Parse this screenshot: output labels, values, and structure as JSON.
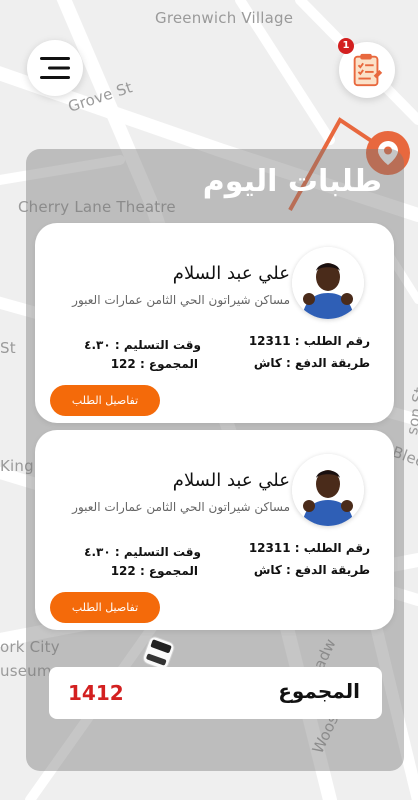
{
  "map": {
    "labels": {
      "greenwich": "Greenwich Village",
      "grove": "Grove St",
      "cherry": "Cherry Lane Theatre",
      "st": "St",
      "king": "King S",
      "york_city": "ork City",
      "museum": "useum",
      "hudson": "son St",
      "blee": "Blee",
      "road": "roadw",
      "woos": "Woos"
    }
  },
  "header": {
    "notification_count": "1"
  },
  "panel": {
    "title": "طلبات اليوم"
  },
  "orders": [
    {
      "customer_name": "علي عبد السلام",
      "address": "مساكن شيراتون الحي الثامن عمارات العبور",
      "order_number": "رقم الطلب : 12311",
      "payment_method": "طريقة الدفع : كاش",
      "delivery_time": "وقت التسليم : ٤.٣٠",
      "total": "المجموع : 122",
      "details_button": "تفاصيل الطلب"
    },
    {
      "customer_name": "علي عبد السلام",
      "address": "مساكن شيراتون الحي الثامن عمارات العبور",
      "order_number": "رقم الطلب : 12311",
      "payment_method": "طريقة الدفع : كاش",
      "delivery_time": "وقت التسليم : ٤.٣٠",
      "total": "المجموع : 122",
      "details_button": "تفاصيل الطلب"
    }
  ],
  "summary": {
    "label": "المجموع",
    "value": "1412"
  },
  "colors": {
    "accent": "#f46a0a",
    "route": "#e8683e",
    "total": "#d32020"
  },
  "icons": {
    "menu": "menu-icon",
    "orders": "clipboard-checklist-icon",
    "pin": "location-pin-icon",
    "taxi": "taxi-car-icon"
  }
}
